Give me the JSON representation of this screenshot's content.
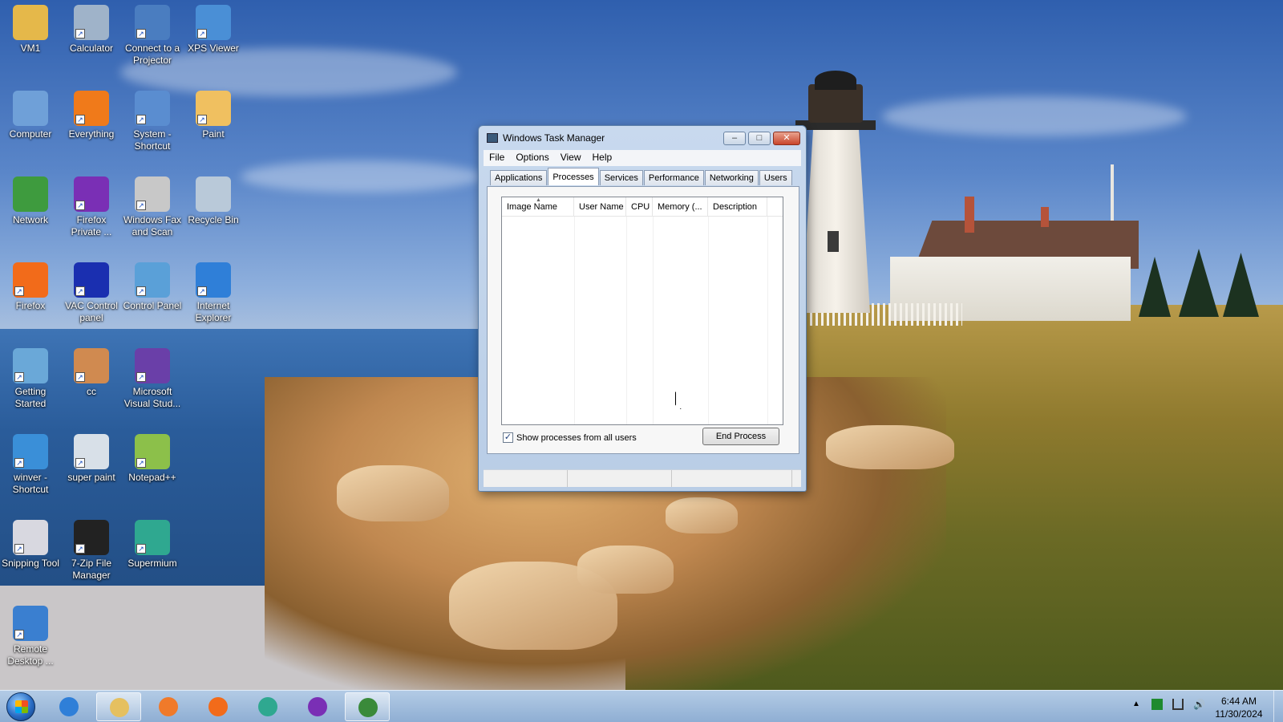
{
  "desktop": {
    "icons": [
      {
        "label": "VM1",
        "icon": "folder-user-icon",
        "color": "#e5b84a"
      },
      {
        "label": "Calculator",
        "icon": "calculator-icon",
        "color": "#9fb3c9"
      },
      {
        "label": "Connect to a Projector",
        "icon": "projector-icon",
        "color": "#4a7dc0"
      },
      {
        "label": "XPS Viewer",
        "icon": "xps-viewer-icon",
        "color": "#4a8fd6"
      },
      {
        "label": "Computer",
        "icon": "computer-icon",
        "color": "#6fa0d8"
      },
      {
        "label": "Everything",
        "icon": "everything-search-icon",
        "color": "#f07a1a"
      },
      {
        "label": "System - Shortcut",
        "icon": "system-icon",
        "color": "#5a8dd0"
      },
      {
        "label": "Paint",
        "icon": "paint-palette-icon",
        "color": "#f0c060"
      },
      {
        "label": "Network",
        "icon": "network-globe-icon",
        "color": "#3e9b3e"
      },
      {
        "label": "Firefox Private ...",
        "icon": "firefox-private-icon",
        "color": "#7a2fb5"
      },
      {
        "label": "Windows Fax and Scan",
        "icon": "fax-icon",
        "color": "#c8c8c8"
      },
      {
        "label": "Recycle Bin",
        "icon": "recycle-bin-icon",
        "color": "#b9c9d9"
      },
      {
        "label": "Firefox",
        "icon": "firefox-icon",
        "color": "#f26b1a"
      },
      {
        "label": "VAC Control panel",
        "icon": "vac-control-icon",
        "color": "#1a2fb0"
      },
      {
        "label": "Control Panel",
        "icon": "control-panel-icon",
        "color": "#5aa0d8"
      },
      {
        "label": "Internet Explorer",
        "icon": "internet-explorer-icon",
        "color": "#2f7fd8"
      },
      {
        "label": "Getting Started",
        "icon": "getting-started-icon",
        "color": "#6aa8d8"
      },
      {
        "label": "cc",
        "icon": "image-file-icon",
        "color": "#d08a50"
      },
      {
        "label": "Microsoft Visual Stud...",
        "icon": "visual-studio-icon",
        "color": "#6a3fa8"
      },
      {
        "label": "winver - Shortcut",
        "icon": "windows-logo-icon",
        "color": "#3a8fd8"
      },
      {
        "label": "super paint",
        "icon": "super-paint-icon",
        "color": "#d8e0e8"
      },
      {
        "label": "Notepad++",
        "icon": "notepad-plus-plus-icon",
        "color": "#8cc04a"
      },
      {
        "label": "Snipping Tool",
        "icon": "snipping-tool-icon",
        "color": "#d8d8e0"
      },
      {
        "label": "7-Zip File Manager",
        "icon": "seven-zip-icon",
        "color": "#222222"
      },
      {
        "label": "Supermium",
        "icon": "supermium-icon",
        "color": "#2fa890"
      },
      {
        "label": "Remote Desktop ...",
        "icon": "remote-desktop-icon",
        "color": "#3a7fd0"
      }
    ]
  },
  "window": {
    "title": "Windows Task Manager",
    "buttons": {
      "minimize": "–",
      "maximize": "□",
      "close": "✕"
    },
    "menu": [
      "File",
      "Options",
      "View",
      "Help"
    ],
    "tabs": [
      "Applications",
      "Processes",
      "Services",
      "Performance",
      "Networking",
      "Users"
    ],
    "active_tab": "Processes",
    "columns": [
      "Image Name",
      "User Name",
      "CPU",
      "Memory (...",
      "Description"
    ],
    "rows": [],
    "show_all_users": {
      "label": "Show processes from all users",
      "checked": true
    },
    "end_process_label": "End Process",
    "status_bar": [
      "",
      "",
      ""
    ]
  },
  "taskbar": {
    "apps": [
      {
        "name": "internet-explorer",
        "color": "#2f7fd8",
        "active": false
      },
      {
        "name": "windows-explorer",
        "color": "#e5c060",
        "active": true
      },
      {
        "name": "media-player",
        "color": "#f07a2a",
        "active": false
      },
      {
        "name": "firefox",
        "color": "#f26b1a",
        "active": false
      },
      {
        "name": "supermium",
        "color": "#2fa890",
        "active": false
      },
      {
        "name": "firefox-private",
        "color": "#7a2fb5",
        "active": false
      },
      {
        "name": "task-manager",
        "color": "#3a8a3a",
        "active": true
      }
    ],
    "clock_time": "6:44 AM",
    "clock_date": "11/30/2024"
  }
}
